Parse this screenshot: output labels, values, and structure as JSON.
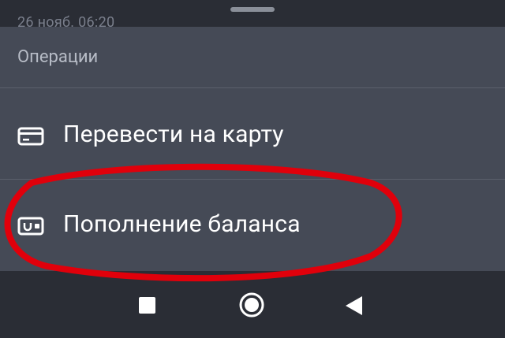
{
  "background": {
    "date_text": "26 нояб. 06:20"
  },
  "sheet": {
    "title": "Операции",
    "items": [
      {
        "icon": "credit-card-icon",
        "label": "Перевести на карту"
      },
      {
        "icon": "wallet-icon",
        "label": "Пополнение баланса"
      }
    ]
  },
  "navbar": {
    "buttons": [
      "recents-square-icon",
      "home-circle-icon",
      "back-triangle-icon"
    ]
  },
  "colors": {
    "sheet_bg": "#454a56",
    "nav_bg": "#2a2d35",
    "highlight": "#e0000b"
  }
}
